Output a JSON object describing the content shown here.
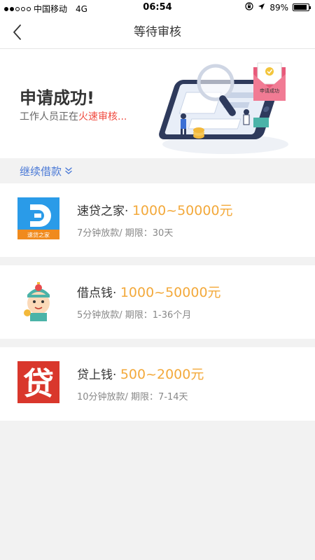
{
  "status_bar": {
    "carrier": "中国移动",
    "network": "4G",
    "time": "06:54",
    "battery": "89%",
    "battery_level": 0.89
  },
  "nav": {
    "title": "等待审核"
  },
  "hero": {
    "title": "申请成功!",
    "subtitle_prefix": "工作人员正在",
    "subtitle_highlight": "火速审核...",
    "envelope_label": "申请成功"
  },
  "continue": {
    "label": "继续借款"
  },
  "loans": [
    {
      "name": "速贷之家·",
      "amount": "1000~50000元",
      "meta": "7分钟放款/ 期限：30天",
      "logo_text": "速贷之家",
      "logo_icon": "sudai-logo"
    },
    {
      "name": "借点钱·",
      "amount": "1000~50000元",
      "meta": "5分钟放款/ 期限：1-36个月",
      "logo_icon": "jiedianqian-logo"
    },
    {
      "name": "贷上钱·",
      "amount": "500~2000元",
      "meta": "10分钟放款/ 期限：7-14天",
      "logo_text": "贷",
      "logo_icon": "daishangqian-logo"
    }
  ],
  "colors": {
    "accent_blue": "#4a79d6",
    "amount_orange": "#f3a93b",
    "highlight_red": "#f04a3f",
    "sudai_blue": "#2a9be8",
    "sudai_orange": "#f08a1d",
    "dai_red": "#d9372c"
  }
}
